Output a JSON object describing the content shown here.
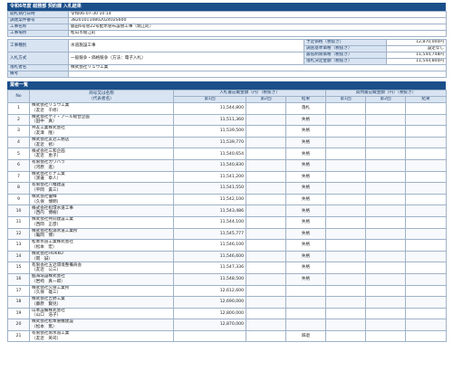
{
  "header": {
    "title": "令和6年度 総務部 契約課 入札結果"
  },
  "summary": {
    "open_date_label": "開札執行日時",
    "open_date": "令和06-07-30 10:14",
    "procure_no_label": "調達案件番号",
    "procure_no": "38201011080202402S600",
    "work_name_label": "工事名称",
    "work_name": "脇田6号管22号配水管布設替工事（堀江町）",
    "work_place_label": "工事場所",
    "work_place": "松山市堀江町",
    "work_type_label": "工事種別",
    "work_type": "水道施設工事",
    "bid_method_label": "入札方式",
    "bid_method": "一般競争・価格競争（方法：電子入札）",
    "winner_label": "落札者名",
    "winner": "株式会社リュウ工業",
    "notes_label": "備考",
    "notes": "",
    "right": [
      {
        "label": "予定価格（税抜き）",
        "value": "12,870,000円"
      },
      {
        "label": "調査基準価格（税抜き）",
        "value": "設定なし"
      },
      {
        "label": "最低制限価格（税抜き）",
        "value": "11,544,748円"
      },
      {
        "label": "落札決定金額（税抜き）",
        "value": "11,544,800円"
      }
    ]
  },
  "results": {
    "section_title": "業者一覧",
    "col_no": "No",
    "col_name": "商号又は名称\n（代表者名）",
    "col_bid_group": "入札書記載金額（円）（税抜き）",
    "col_bid1": "第1回",
    "col_bid2": "第2回",
    "col_result": "結果",
    "col_qual_group": "質問書記載金額（円）（税抜き）",
    "col_qual1": "第1回",
    "col_qual2": "第2回",
    "col_qual_result": "結果",
    "rows": [
      {
        "no": "1",
        "name": "株式会社リュウ工業",
        "rep": "（友近　千修）",
        "bid": "11,544,800",
        "result": "落札"
      },
      {
        "no": "2",
        "name": "株式会社ケイ・アール総合企画",
        "rep": "（田中　真）",
        "bid": "11,511,360",
        "result": "失格"
      },
      {
        "no": "3",
        "name": "共友工業株式会社",
        "rep": "（友澤　隆）",
        "bid": "11,539,500",
        "result": "失格"
      },
      {
        "no": "4",
        "name": "株式会社友近工務店",
        "rep": "（友近　修）",
        "bid": "11,539,770",
        "result": "失格"
      },
      {
        "no": "5",
        "name": "株式会社三和企画",
        "rep": "（友近　恵子）",
        "bid": "11,540,654",
        "result": "失格"
      },
      {
        "no": "6",
        "name": "有限会社カワハラ",
        "rep": "（河原　進）",
        "bid": "11,540,830",
        "result": "失格"
      },
      {
        "no": "7",
        "name": "株式会社ヒナ工業",
        "rep": "（渡邊　章人）",
        "bid": "11,541,200",
        "result": "失格"
      },
      {
        "no": "8",
        "name": "有限会社八幡建設",
        "rep": "（平岡　貴三）",
        "bid": "11,541,550",
        "result": "失格"
      },
      {
        "no": "9",
        "name": "株式会社優輝",
        "rep": "（久保　博明）",
        "bid": "11,542,100",
        "result": "失格"
      },
      {
        "no": "10",
        "name": "株式会社松環水道工事",
        "rep": "（西内　博樹）",
        "bid": "11,543,486",
        "result": "失格"
      },
      {
        "no": "11",
        "name": "株式会社共同建設工業",
        "rep": "（西岡　正彦）",
        "bid": "11,544,100",
        "result": "失格"
      },
      {
        "no": "12",
        "name": "株式会社松浦水道工業所",
        "rep": "（亀岡　博）",
        "bid": "11,545,777",
        "result": "失格"
      },
      {
        "no": "13",
        "name": "松本水道工業株式会社",
        "rep": "（松本　宏）",
        "bid": "11,546,100",
        "result": "失格"
      },
      {
        "no": "14",
        "name": "株式会社HOKKO",
        "rep": "（岡　誠）",
        "bid": "11,546,600",
        "result": "失格"
      },
      {
        "no": "15",
        "name": "有限会社五近環境整備商会",
        "rep": "（友近　公三）",
        "bid": "11,547,336",
        "result": "失格"
      },
      {
        "no": "16",
        "name": "臨海環設株式会社",
        "rep": "（岩崎　真一郎）",
        "bid": "11,548,500",
        "result": "失格"
      },
      {
        "no": "17",
        "name": "株式会社久保工業所",
        "rep": "（久保　雄三）",
        "bid": "12,612,600",
        "result": ""
      },
      {
        "no": "18",
        "name": "株式会社吉野工業",
        "rep": "（藤原　賢児）",
        "bid": "12,690,000",
        "result": ""
      },
      {
        "no": "19",
        "name": "山本設備株式会社",
        "rep": "（山口　浩子）",
        "bid": "12,800,000",
        "result": ""
      },
      {
        "no": "20",
        "name": "株式会社松本重機建設",
        "rep": "（松本　篤）",
        "bid": "12,870,000",
        "result": ""
      },
      {
        "no": "21",
        "name": "有限会社南水道工業",
        "rep": "（友近　英司）",
        "bid": "",
        "result": "辞退"
      }
    ]
  }
}
